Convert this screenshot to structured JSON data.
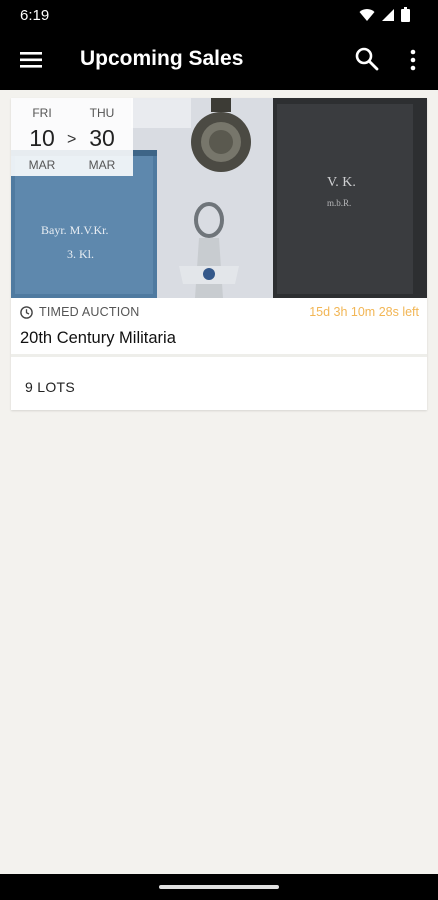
{
  "status_bar": {
    "time": "6:19"
  },
  "app_bar": {
    "title": "Upcoming Sales"
  },
  "sale": {
    "start_dow": "FRI",
    "start_day": "10",
    "start_month": "MAR",
    "end_dow": "THU",
    "end_day": "30",
    "end_month": "MAR",
    "range_separator": ">",
    "type": "TIMED AUCTION",
    "time_left": "15d 3h 10m 28s left",
    "title": "20th Century Militaria",
    "lots": "9 LOTS"
  },
  "colors": {
    "accent_time_left": "#f2b655",
    "app_bar_bg": "#000000",
    "page_bg": "#f3f2ee"
  }
}
